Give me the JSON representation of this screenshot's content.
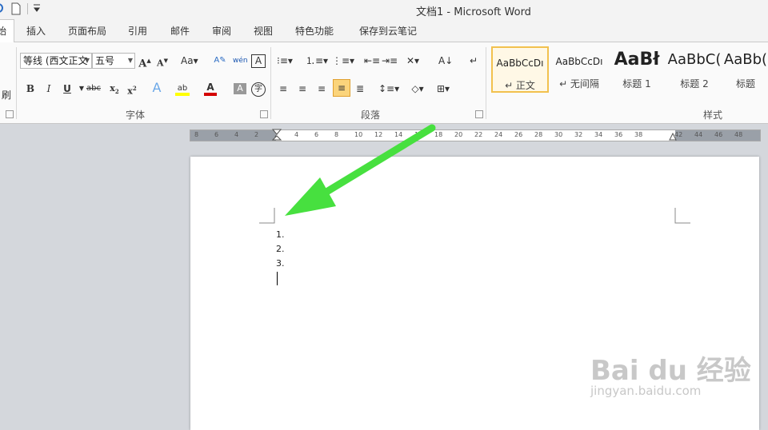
{
  "window": {
    "title": "文档1 - Microsoft Word"
  },
  "tabs": [
    "始",
    "插入",
    "页面布局",
    "引用",
    "邮件",
    "审阅",
    "视图",
    "特色功能",
    "保存到云笔记"
  ],
  "font_group": {
    "font_name": "等线 (西文正文",
    "font_size": "五号",
    "label": "字体",
    "format_painter_fragment": "刷"
  },
  "paragraph_group": {
    "label": "段落"
  },
  "styles_group": {
    "label": "样式",
    "items": [
      {
        "sample": "AaBbCcDı",
        "name": "↵ 正文"
      },
      {
        "sample": "AaBbCcDı",
        "name": "↵ 无间隔"
      },
      {
        "sample": "AaBł",
        "name": "标题 1"
      },
      {
        "sample": "AaBbC(",
        "name": "标题 2"
      },
      {
        "sample": "AaBb(",
        "name": "标题"
      }
    ]
  },
  "ruler": {
    "numbers": [
      "8",
      "6",
      "4",
      "2",
      "2",
      "4",
      "6",
      "8",
      "10",
      "12",
      "14",
      "16",
      "18",
      "20",
      "22",
      "24",
      "26",
      "28",
      "30",
      "32",
      "34",
      "36",
      "38",
      "42",
      "44",
      "46",
      "48"
    ]
  },
  "document": {
    "list_items": [
      "1.",
      "2.",
      "3."
    ]
  },
  "watermark": {
    "brand": "Bai du 经验",
    "url": "jingyan.baidu.com"
  },
  "colors": {
    "arrow": "#47e03f",
    "font_color_bar": "#d40000",
    "highlight_bar": "#ffff00",
    "selected_style": "#f2c14e"
  }
}
